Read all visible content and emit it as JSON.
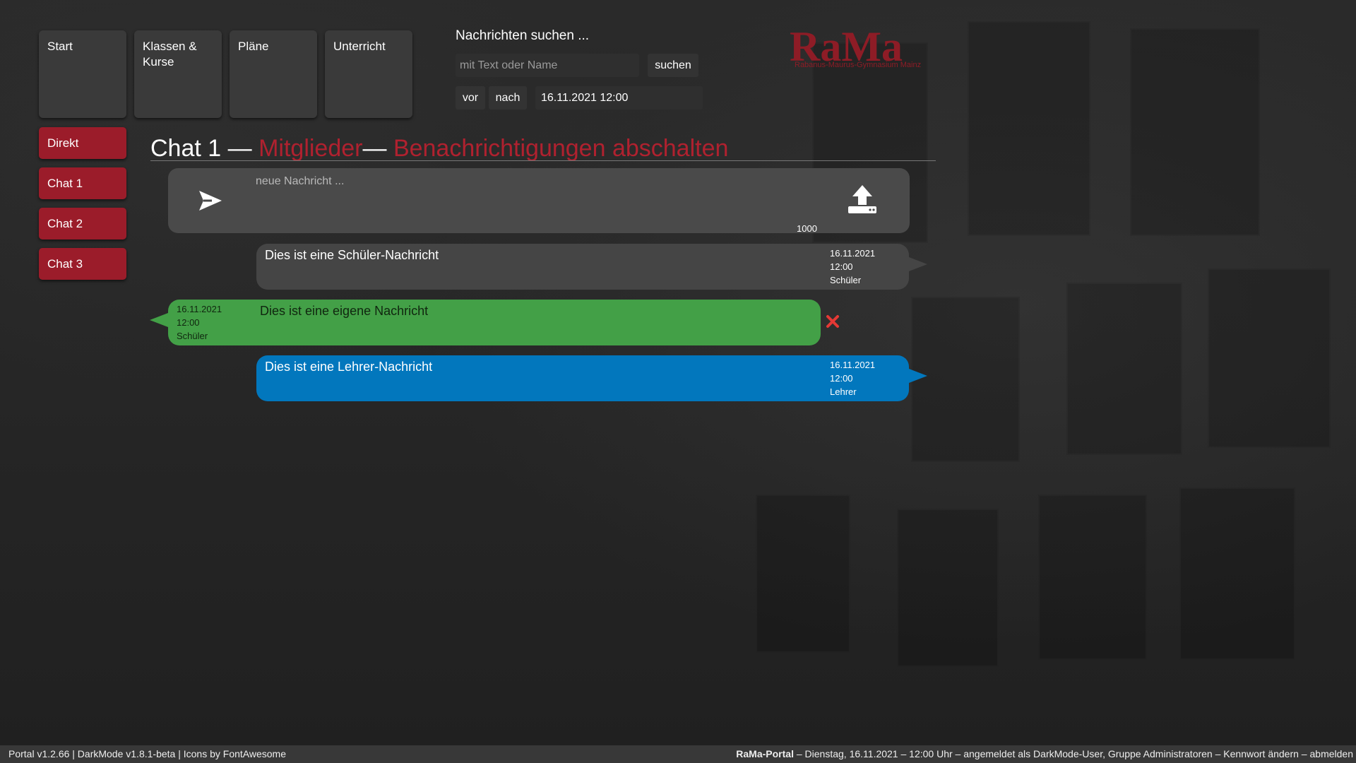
{
  "nav": {
    "tiles": [
      {
        "label": "Start"
      },
      {
        "label": "Klassen & Kurse"
      },
      {
        "label": "Pläne"
      },
      {
        "label": "Unterricht"
      }
    ]
  },
  "search": {
    "title": "Nachrichten suchen ...",
    "placeholder": "mit Text oder Name",
    "button_label": "suchen",
    "before_label": "vor",
    "after_label": "nach",
    "datetime_value": "16.11.2021 12:00"
  },
  "logo": {
    "wordmark": "RaMa",
    "subtitle": "Rabanus-Maurus-Gymnasium Mainz",
    "color": "#8e1c26"
  },
  "sidebar": {
    "items": [
      {
        "label": "Direkt"
      },
      {
        "label": "Chat 1"
      },
      {
        "label": "Chat 2"
      },
      {
        "label": "Chat 3"
      }
    ],
    "color": "#9b1c2a"
  },
  "chat": {
    "title": "Chat 1",
    "separator": "—",
    "members_link": "Mitglieder",
    "mute_link": "Benachrichtigungen abschalten",
    "accent": "#b0212f"
  },
  "composer": {
    "placeholder": "neue Nachricht ...",
    "char_limit": "1000",
    "send_icon": "send-icon",
    "upload_icon": "upload-icon"
  },
  "messages": [
    {
      "kind": "student",
      "text": "Dies ist eine Schüler-Nachricht",
      "date": "16.11.2021",
      "time": "12:00",
      "role": "Schüler",
      "color": "#454545"
    },
    {
      "kind": "own",
      "text": "Dies ist eine eigene Nachricht",
      "date": "16.11.2021",
      "time": "12:00",
      "role": "Schüler",
      "color": "#43a047"
    },
    {
      "kind": "teacher",
      "text": "Dies ist eine Lehrer-Nachricht",
      "date": "16.11.2021",
      "time": "12:00",
      "role": "Lehrer",
      "color": "#0277bd"
    }
  ],
  "delete_icon": "close-icon",
  "footer": {
    "left": "Portal v1.2.66 | DarkMode v1.8.1-beta | Icons by FontAwesome",
    "brand": "RaMa-Portal",
    "status": " – Dienstag, 16.11.2021 – 12:00 Uhr – angemeldet als DarkMode-User, Gruppe Administratoren – ",
    "change_password": "Kennwort ändern",
    "dash": " – ",
    "logout": "abmelden"
  }
}
